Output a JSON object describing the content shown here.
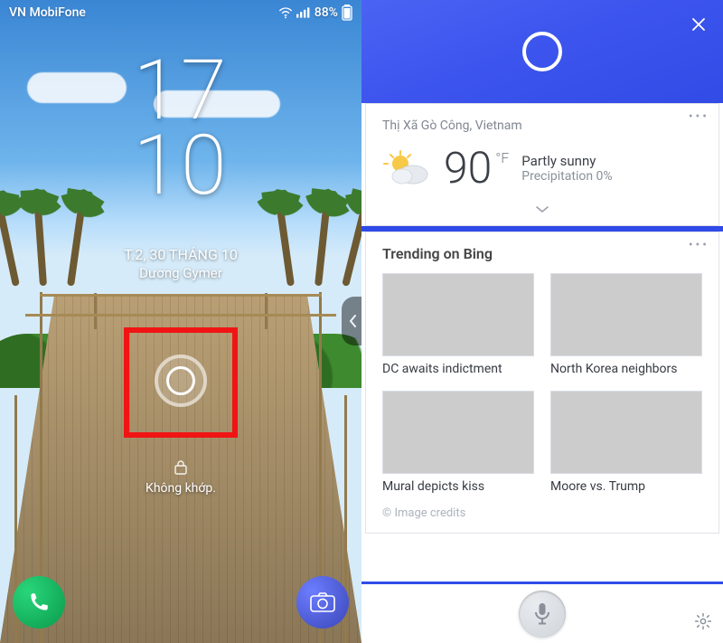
{
  "statusbar": {
    "carrier": "VN MobiFone",
    "battery_pct": "88%",
    "wifi_icon": "wifi",
    "signal_icon": "signal",
    "battery_icon": "battery"
  },
  "lockscreen": {
    "time_top": "17",
    "time_bottom": "10",
    "date_line": "T.2, 30 THÁNG 10",
    "user_line": "Dương Gymer",
    "lock_msg": "Không khớp.",
    "shortcuts": {
      "phone": "phone",
      "camera": "camera"
    },
    "edge_panel": "edge-panel",
    "cortana_shortcut": "cortana"
  },
  "annotation": {
    "highlight": "red-box"
  },
  "cortana": {
    "header_icon": "cortana-ring",
    "close_icon": "close",
    "weather": {
      "location": "Thị Xã Gò Công, Vietnam",
      "icon": "partly-sunny",
      "temp": "90",
      "unit": "°F",
      "condition": "Partly sunny",
      "precip": "Precipitation 0%",
      "more_icon": "more",
      "expand_icon": "chevron-down"
    },
    "trending": {
      "title": "Trending on Bing",
      "more_icon": "more",
      "items": [
        {
          "caption": "DC awaits indictment"
        },
        {
          "caption": "North Korea neighbors"
        },
        {
          "caption": "Mural depicts kiss"
        },
        {
          "caption": "Moore vs. Trump"
        }
      ],
      "credits": "© Image credits"
    },
    "bottom": {
      "mic_icon": "microphone",
      "settings_icon": "settings"
    }
  }
}
